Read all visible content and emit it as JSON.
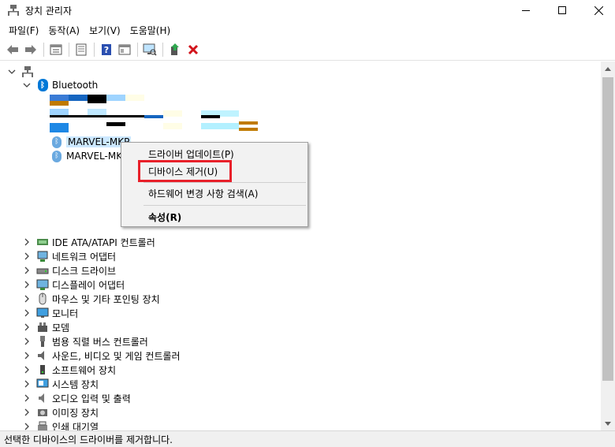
{
  "window": {
    "title": "장치 관리자",
    "icon": "device-manager-icon"
  },
  "menu": [
    "파일(F)",
    "동작(A)",
    "보기(V)",
    "도움말(H)"
  ],
  "toolbar": {
    "buttons": [
      "back-arrow-icon",
      "forward-arrow-icon",
      "properties-view-icon",
      "list-view-icon",
      "help-icon",
      "console-view-icon",
      "monitor-scan-icon",
      "update-driver-icon",
      "uninstall-x-icon"
    ]
  },
  "tree": {
    "category_bluetooth": "Bluetooth",
    "device_1": "MARVEL-MKP",
    "device_2": "MARVEL-MKP",
    "categories": [
      "IDE ATA/ATAPI 컨트롤러",
      "네트워크 어댑터",
      "디스크 드라이브",
      "디스플레이 어댑터",
      "마우스 및 기타 포인팅 장치",
      "모니터",
      "모뎀",
      "범용 직렬 버스 컨트롤러",
      "사운드, 비디오 및 게임 컨트롤러",
      "소프트웨어 장치",
      "시스템 장치",
      "오디오 입력 및 출력",
      "이미징 장치",
      "인쇄 대기열"
    ]
  },
  "context_menu": {
    "update_driver": "드라이버 업데이트(P)",
    "uninstall_device": "디바이스 제거(U)",
    "scan_hardware": "하드웨어 변경 사항 검색(A)",
    "properties": "속성(R)"
  },
  "status": "선택한 디바이스의 드라이버를 제거합니다.",
  "colors": {
    "highlight": "#e8202a",
    "selection": "#cce8ff",
    "bluetooth": "#0078d7"
  }
}
